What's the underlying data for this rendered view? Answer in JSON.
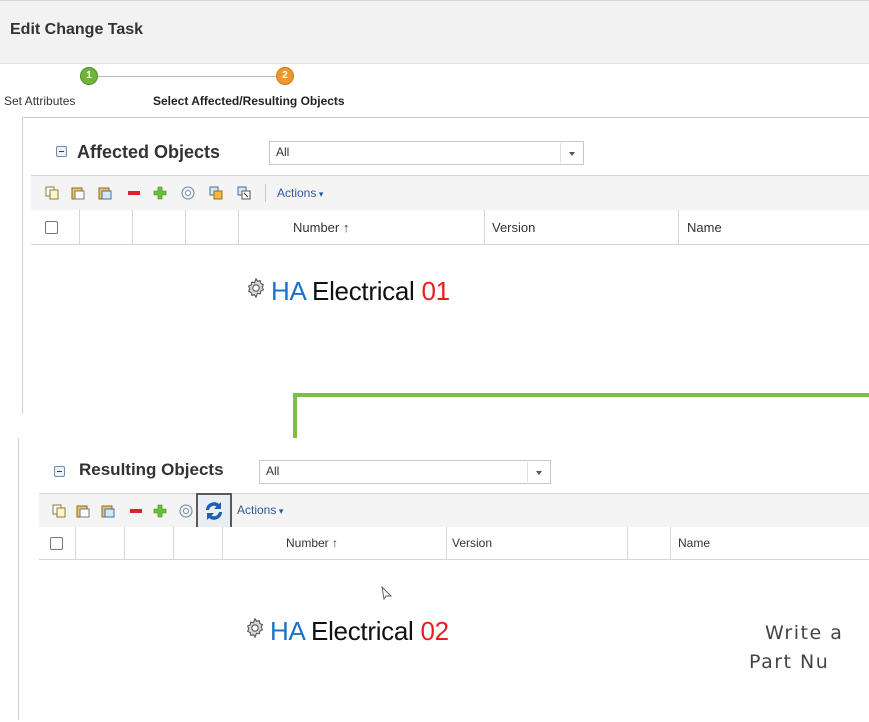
{
  "header": {
    "title": "Edit Change Task"
  },
  "wizard": {
    "steps": [
      {
        "number": "1",
        "label": "Set Attributes",
        "color": "#6fb43a"
      },
      {
        "number": "2",
        "label": "Select Affected/Resulting Objects",
        "color": "#f0962f"
      }
    ]
  },
  "affected": {
    "title": "Affected Objects",
    "filter_value": "All",
    "actions_label": "Actions",
    "columns": [
      "Number ↑",
      "Version",
      "Name"
    ],
    "overlay": {
      "part1": "HA",
      "part2": "Electrical",
      "part3": "01"
    }
  },
  "resulting": {
    "title": "Resulting Objects",
    "filter_value": "All",
    "actions_label": "Actions",
    "columns": [
      "Number ↑",
      "Version",
      "Name"
    ],
    "overlay": {
      "part1": "HA",
      "part2": "Electrical",
      "part3": "02"
    }
  },
  "annotation": {
    "line1": "Write a",
    "line2": "Part Nu"
  },
  "colors": {
    "accent_blue": "#1a73c9",
    "accent_red": "#e81e1e",
    "connector_green": "#7cc043"
  },
  "icons": [
    "copy-icon",
    "paste-icon",
    "paste-special-icon",
    "remove-icon",
    "add-icon",
    "info-icon",
    "revise-icon",
    "revise-alt-icon",
    "refresh-icon",
    "gear-icon",
    "cursor-icon"
  ]
}
